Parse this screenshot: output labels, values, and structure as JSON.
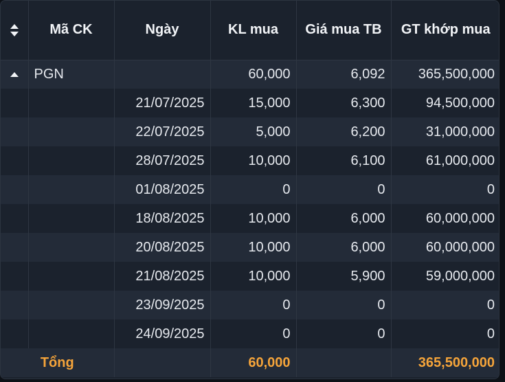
{
  "table": {
    "headers": {
      "sort_icon": "sort-icon",
      "code": "Mã CK",
      "date": "Ngày",
      "buy_volume": "KL mua",
      "avg_buy_price": "Giá mua TB",
      "matched_buy_value": "GT khớp mua"
    },
    "group": {
      "icon": "caret-up-icon",
      "code": "PGN",
      "buy_volume": "60,000",
      "avg_buy_price": "6,092",
      "matched_buy_value": "365,500,000"
    },
    "rows": [
      {
        "date": "21/07/2025",
        "buy_volume": "15,000",
        "avg_buy_price": "6,300",
        "matched_buy_value": "94,500,000"
      },
      {
        "date": "22/07/2025",
        "buy_volume": "5,000",
        "avg_buy_price": "6,200",
        "matched_buy_value": "31,000,000"
      },
      {
        "date": "28/07/2025",
        "buy_volume": "10,000",
        "avg_buy_price": "6,100",
        "matched_buy_value": "61,000,000"
      },
      {
        "date": "01/08/2025",
        "buy_volume": "0",
        "avg_buy_price": "0",
        "matched_buy_value": "0"
      },
      {
        "date": "18/08/2025",
        "buy_volume": "10,000",
        "avg_buy_price": "6,000",
        "matched_buy_value": "60,000,000"
      },
      {
        "date": "20/08/2025",
        "buy_volume": "10,000",
        "avg_buy_price": "6,000",
        "matched_buy_value": "60,000,000"
      },
      {
        "date": "21/08/2025",
        "buy_volume": "10,000",
        "avg_buy_price": "5,900",
        "matched_buy_value": "59,000,000"
      },
      {
        "date": "23/09/2025",
        "buy_volume": "0",
        "avg_buy_price": "0",
        "matched_buy_value": "0"
      },
      {
        "date": "24/09/2025",
        "buy_volume": "0",
        "avg_buy_price": "0",
        "matched_buy_value": "0"
      }
    ],
    "total": {
      "label": "Tổng",
      "buy_volume": "60,000",
      "avg_buy_price": "",
      "matched_buy_value": "365,500,000"
    }
  },
  "colors": {
    "background": "#1b222d",
    "row_alt": "#232b38",
    "text": "#e6e9ee",
    "total_accent": "#f5a43a"
  }
}
